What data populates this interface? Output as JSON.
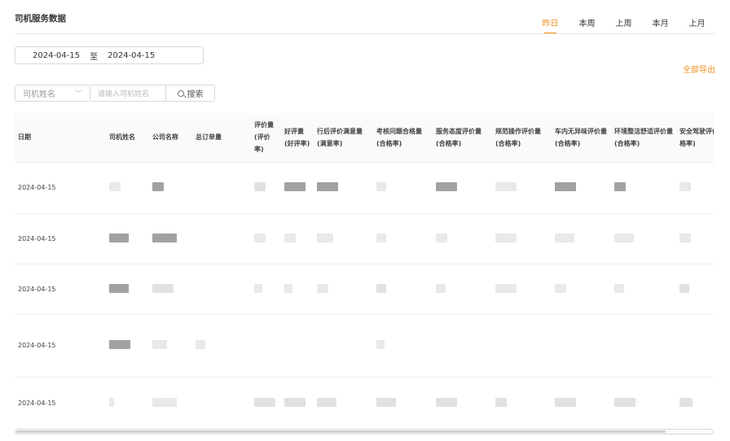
{
  "page": {
    "title": "司机服务数据"
  },
  "tabs": [
    {
      "label": "昨日",
      "active": true
    },
    {
      "label": "本周",
      "active": false
    },
    {
      "label": "上周",
      "active": false
    },
    {
      "label": "本月",
      "active": false
    },
    {
      "label": "上月",
      "active": false
    }
  ],
  "date_range": {
    "start": "2024-04-15",
    "separator": "至",
    "end": "2024-04-15"
  },
  "export_label": "全部导出",
  "filter": {
    "select_label": "司机姓名",
    "input_placeholder": "请输入司机姓名",
    "search_label": "搜索"
  },
  "table": {
    "columns": [
      "日期",
      "司机姓名",
      "公司名称",
      "总订单量",
      "评价量(评价率)",
      "好评量(好评率)",
      "行后评价满意量(满意率)",
      "考核问题合格量(合格率)",
      "服务态度评价量(合格率)",
      "规范操作评价量(合格率)",
      "车内无异味评价量(合格率)",
      "环境整洁舒适评价量(合格率)",
      "安全驾驶评价量(合格率)"
    ],
    "rows": [
      {
        "date": "2024-04-15"
      },
      {
        "date": "2024-04-15"
      },
      {
        "date": "2024-04-15"
      },
      {
        "date": "2024-04-15"
      },
      {
        "date": "2024-04-15"
      }
    ]
  },
  "colors": {
    "accent": "#f0901f",
    "border": "#d9d9d9",
    "header_bg": "#fafafa"
  }
}
